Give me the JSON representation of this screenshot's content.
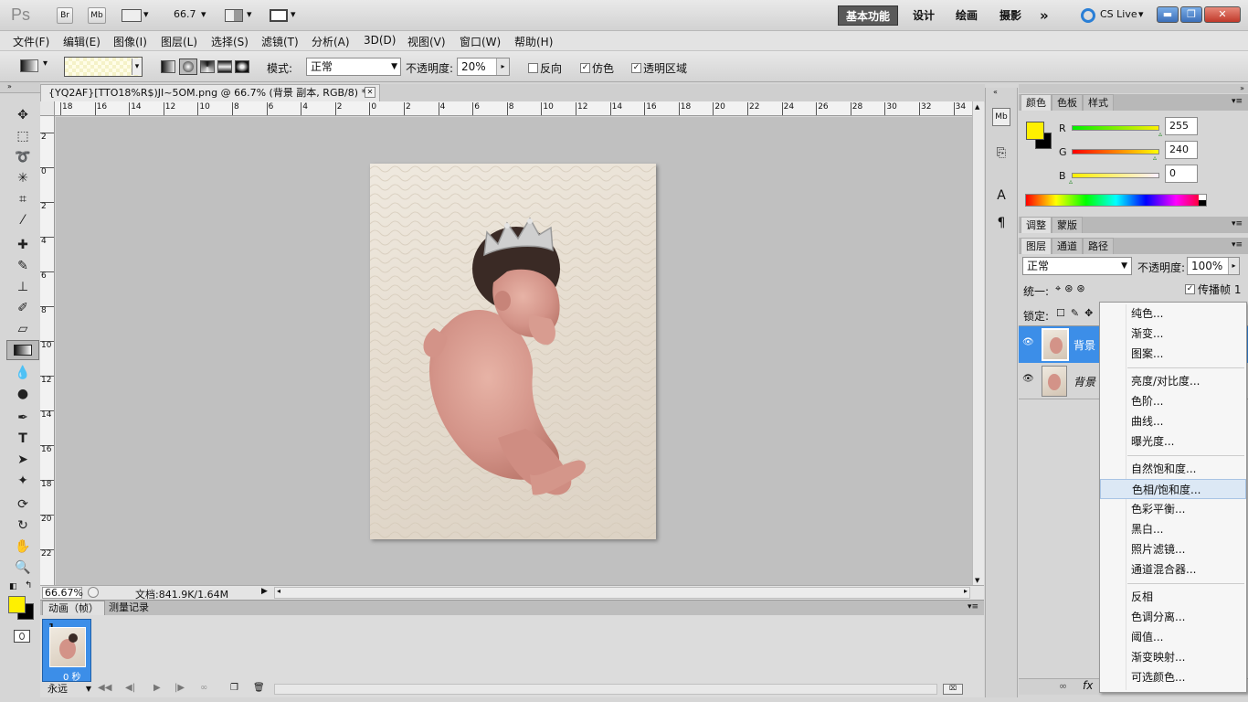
{
  "titlebar": {
    "app_logo": "Ps",
    "br_label": "Br",
    "mb_label": "Mb",
    "zoom_value": "66.7",
    "workspaces": [
      "基本功能",
      "设计",
      "绘画",
      "摄影"
    ],
    "more_label": "»",
    "cslive_label": "CS Live",
    "window_controls": [
      "minimize-icon",
      "restore-icon",
      "close-icon"
    ]
  },
  "menubar": {
    "items": [
      "文件(F)",
      "编辑(E)",
      "图像(I)",
      "图层(L)",
      "选择(S)",
      "滤镜(T)",
      "分析(A)",
      "3D(D)",
      "视图(V)",
      "窗口(W)",
      "帮助(H)"
    ]
  },
  "options": {
    "mode_label": "模式:",
    "mode_value": "正常",
    "opacity_label": "不透明度:",
    "opacity_value": "20%",
    "reverse_label": "反向",
    "reverse_checked": false,
    "dither_label": "仿色",
    "dither_checked": true,
    "transparency_label": "透明区域",
    "transparency_checked": true
  },
  "document": {
    "tab_title": "{YQ2AF}[TTO18%R$)JI~5OM.png @ 66.7% (背景 副本, RGB/8) *",
    "close_glyph": "✕",
    "ruler_h": [
      "18",
      "16",
      "14",
      "12",
      "10",
      "8",
      "6",
      "4",
      "2",
      "0",
      "2",
      "4",
      "6",
      "8",
      "10",
      "12",
      "14",
      "16",
      "18",
      "20",
      "22",
      "24",
      "26",
      "28",
      "30",
      "32",
      "34"
    ],
    "ruler_v": [
      "2",
      "0",
      "2",
      "4",
      "6",
      "8",
      "10",
      "12",
      "14",
      "16",
      "18",
      "20",
      "22"
    ]
  },
  "statusbar": {
    "zoom": "66.67%",
    "doc_info": "文档:841.9K/1.64M"
  },
  "animation": {
    "tabs": [
      "动画（帧）",
      "测量记录"
    ],
    "frame_number": "1",
    "frame_delay": "0 秒",
    "loop_value": "永远"
  },
  "color_panel": {
    "tabs": [
      "颜色",
      "色板",
      "样式"
    ],
    "r_label": "R",
    "r_value": "255",
    "g_label": "G",
    "g_value": "240",
    "b_label": "B",
    "b_value": "0",
    "fg_color": "#fff000",
    "bg_color": "#000000"
  },
  "adjust_panel": {
    "tabs": [
      "调整",
      "蒙版"
    ]
  },
  "layers_panel": {
    "tabs": [
      "图层",
      "通道",
      "路径"
    ],
    "blend_mode": "正常",
    "opacity_label": "不透明度:",
    "opacity_value": "100%",
    "unify_label": "统一:",
    "propagate_label": "传播帧 1",
    "propagate_checked": true,
    "lock_label": "锁定:",
    "layers": [
      {
        "name": "背景",
        "selected": true
      },
      {
        "name": "背景",
        "selected": false
      }
    ]
  },
  "context_menu": {
    "groups": [
      [
        "纯色...",
        "渐变...",
        "图案..."
      ],
      [
        "亮度/对比度...",
        "色阶...",
        "曲线...",
        "曝光度..."
      ],
      [
        "自然饱和度...",
        "色相/饱和度...",
        "色彩平衡...",
        "黑白...",
        "照片滤镜...",
        "通道混合器..."
      ],
      [
        "反相",
        "色调分离...",
        "阈值...",
        "渐变映射...",
        "可选颜色..."
      ]
    ],
    "highlighted": "色相/饱和度..."
  },
  "colors": {
    "accent_blue": "#3c8ee8",
    "fg_swatch": "#fff000",
    "canvas_bg": "#c0c0c0"
  }
}
